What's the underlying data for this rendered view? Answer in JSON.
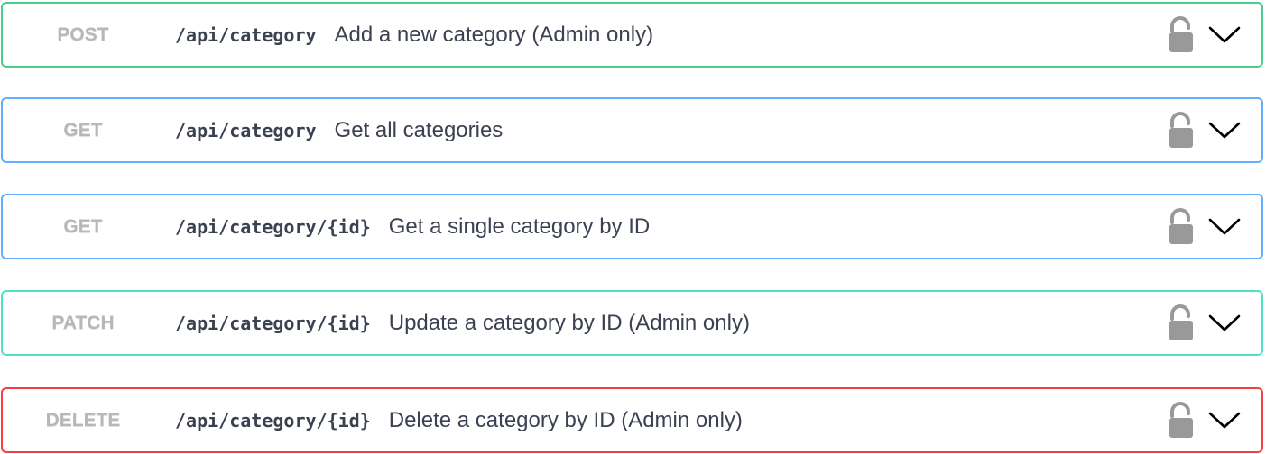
{
  "operations": [
    {
      "method": "POST",
      "path": "/api/category",
      "summary": "Add a new category (Admin only)",
      "color": "#49cc90",
      "lock_icon": "unlocked-padlock-icon",
      "expand_icon": "chevron-down-icon"
    },
    {
      "method": "GET",
      "path": "/api/category",
      "summary": "Get all categories",
      "color": "#61affe",
      "lock_icon": "unlocked-padlock-icon",
      "expand_icon": "chevron-down-icon"
    },
    {
      "method": "GET",
      "path": "/api/category/{id}",
      "summary": "Get a single category by ID",
      "color": "#61affe",
      "lock_icon": "unlocked-padlock-icon",
      "expand_icon": "chevron-down-icon"
    },
    {
      "method": "PATCH",
      "path": "/api/category/{id}",
      "summary": "Update a category by ID (Admin only)",
      "color": "#50e3c2",
      "lock_icon": "unlocked-padlock-icon",
      "expand_icon": "chevron-down-icon"
    },
    {
      "method": "DELETE",
      "path": "/api/category/{id}",
      "summary": "Delete a category by ID (Admin only)",
      "color": "#f93e3e",
      "lock_icon": "unlocked-padlock-icon",
      "expand_icon": "chevron-down-icon"
    }
  ]
}
